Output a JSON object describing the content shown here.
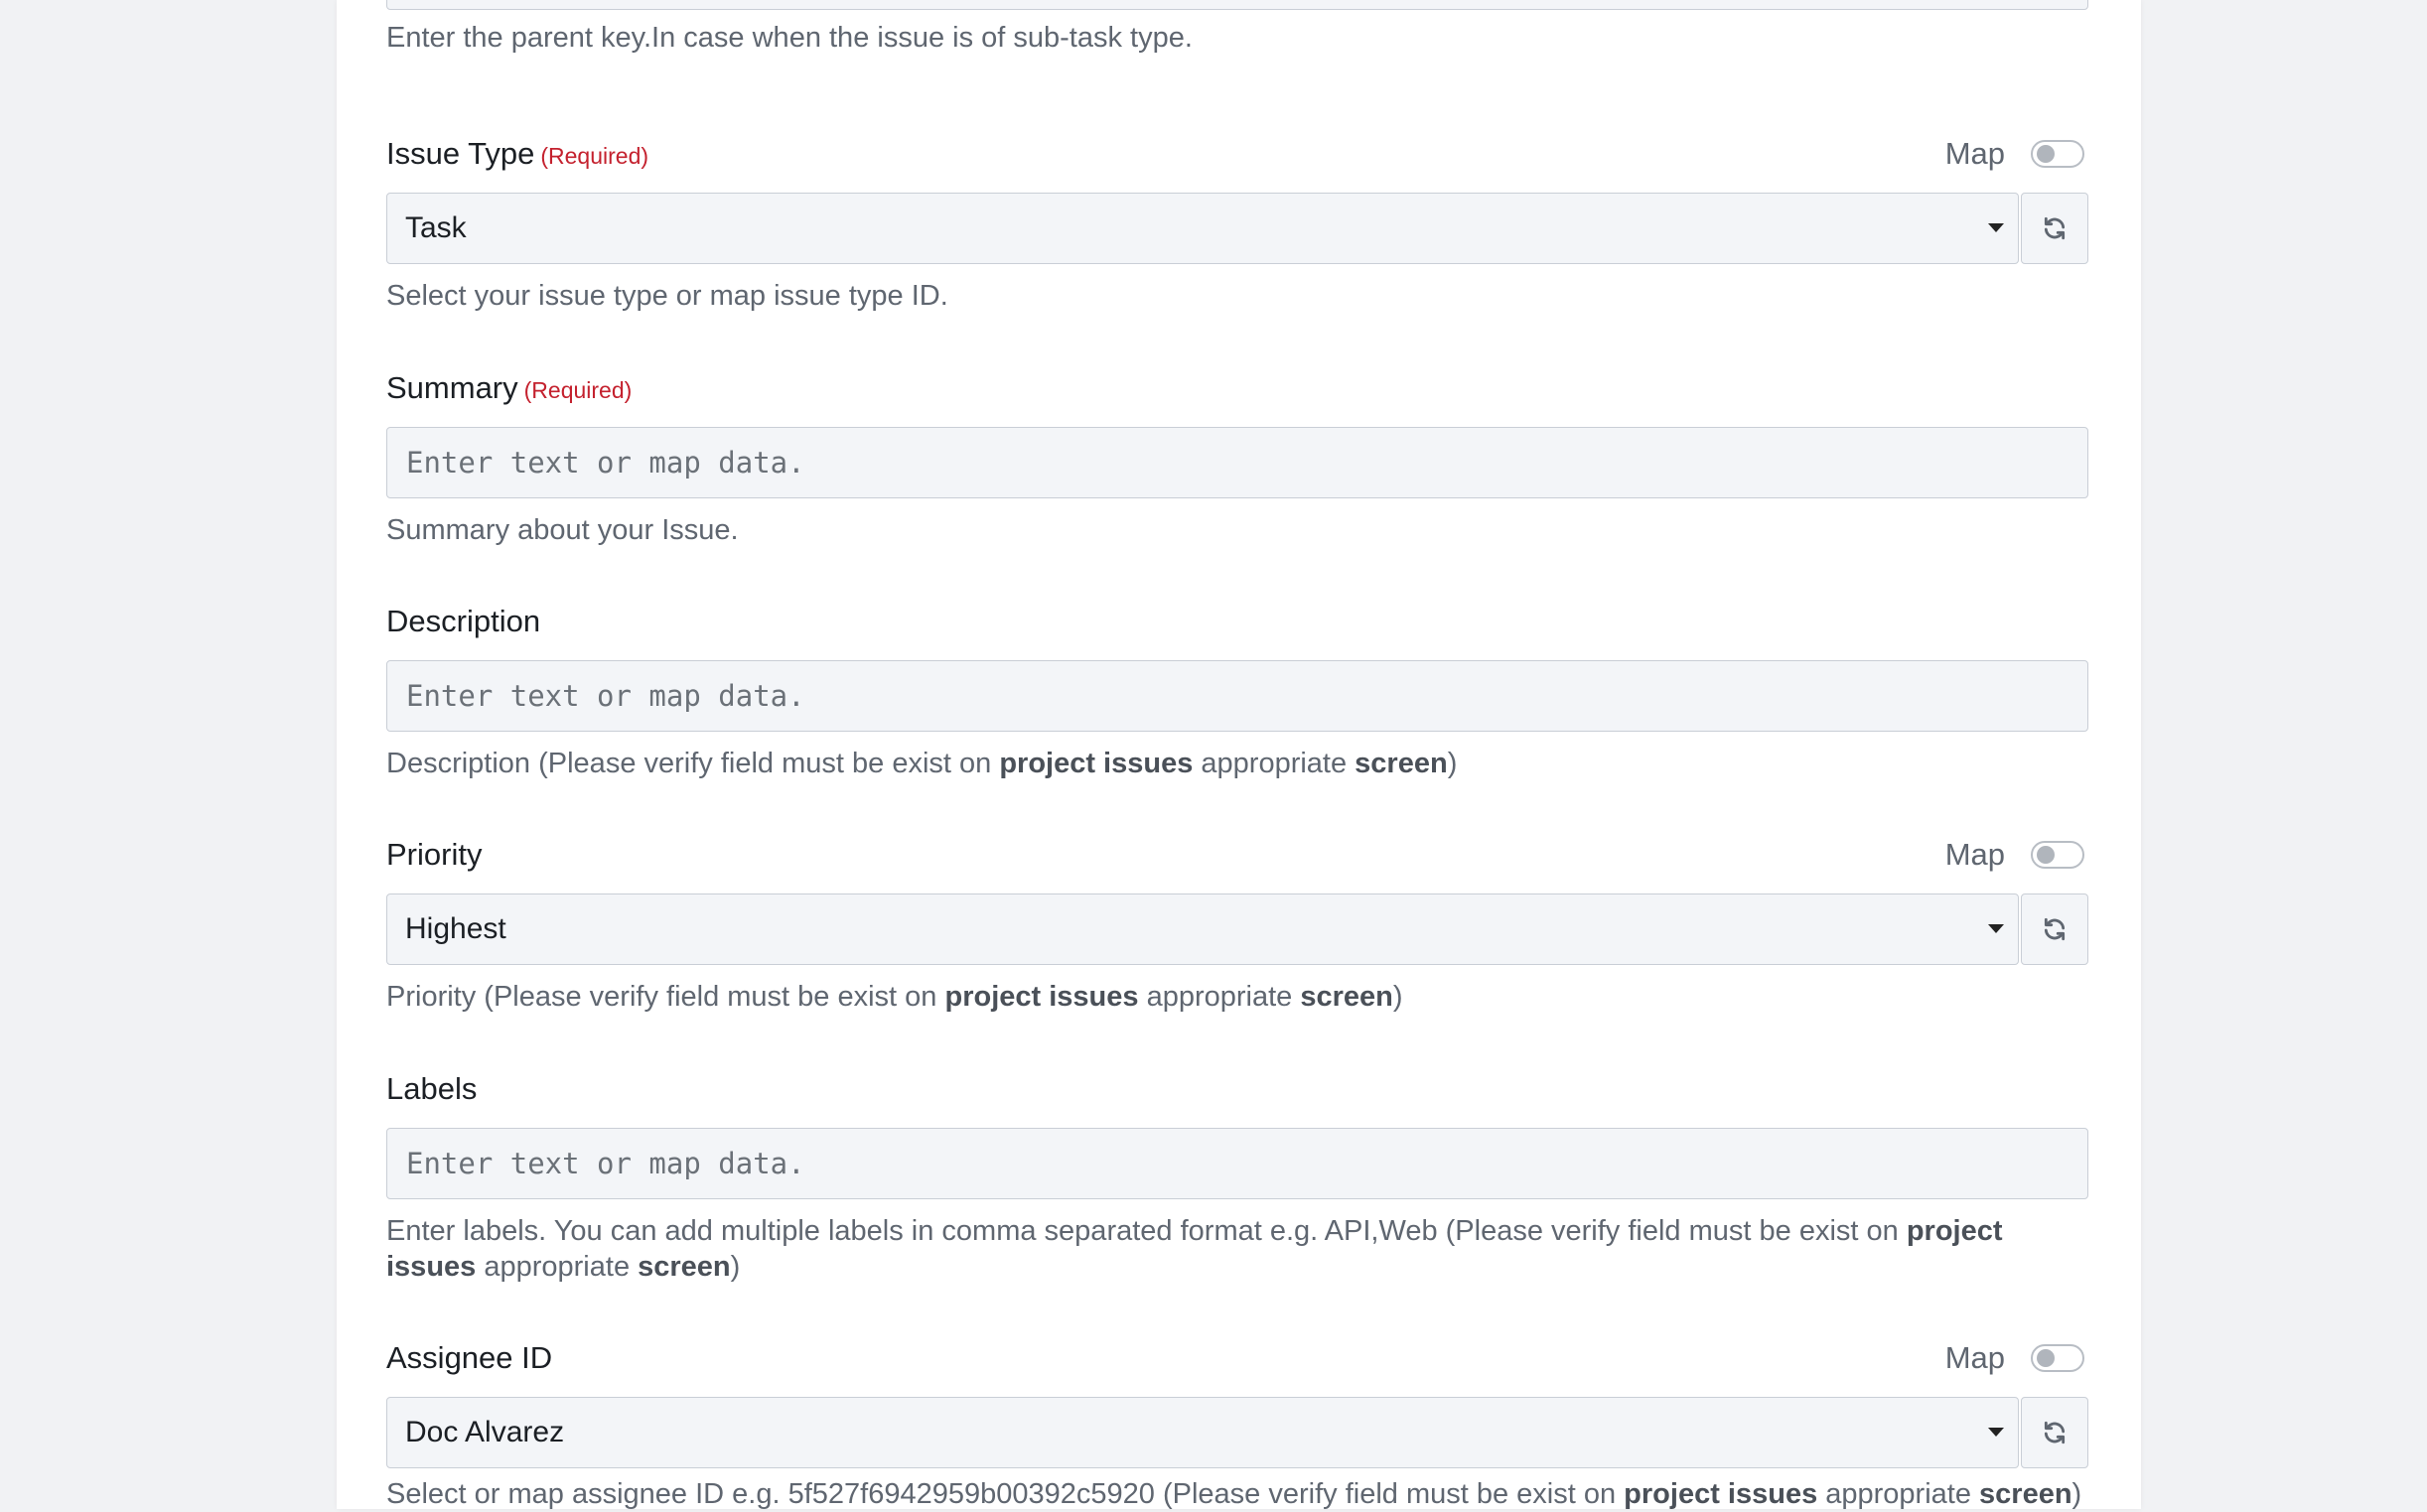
{
  "parent_key": {
    "help": "Enter the parent key.In case when the issue is of sub-task type."
  },
  "issue_type": {
    "label": "Issue Type",
    "required": "(Required)",
    "map_label": "Map",
    "value": "Task",
    "help": "Select your issue type or map issue type ID."
  },
  "summary": {
    "label": "Summary",
    "required": "(Required)",
    "placeholder": "Enter text or map data.",
    "help": "Summary about your Issue."
  },
  "description": {
    "label": "Description",
    "placeholder": "Enter text or map data.",
    "help_prefix": "Description (Please verify field must be exist on ",
    "help_bold1": "project issues",
    "help_middle": " appropriate ",
    "help_bold2": "screen",
    "help_suffix": ")"
  },
  "priority": {
    "label": "Priority",
    "map_label": "Map",
    "value": "Highest",
    "help_prefix": "Priority (Please verify field must be exist on ",
    "help_bold1": "project issues",
    "help_middle": " appropriate ",
    "help_bold2": "screen",
    "help_suffix": ")"
  },
  "labels": {
    "label": "Labels",
    "placeholder": "Enter text or map data.",
    "help_prefix": "Enter labels. You can add multiple labels in comma separated format e.g. API,Web (Please verify field must be exist on ",
    "help_bold1": "project issues",
    "help_middle": " appropriate ",
    "help_bold2": "screen",
    "help_suffix": ")"
  },
  "assignee": {
    "label": "Assignee ID",
    "map_label": "Map",
    "value": "Doc Alvarez",
    "help_prefix": "Select or map assignee ID e.g. 5f527f6942959b00392c5920 (Please verify field must be exist on ",
    "help_bold1": "project issues",
    "help_middle": " appropriate ",
    "help_bold2": "screen",
    "help_suffix": ")"
  },
  "icons": {
    "refresh": "refresh-icon",
    "caret": "caret-down-icon"
  },
  "colors": {
    "required": "#c4212e",
    "field_bg": "#f3f5f8",
    "border": "#c9ced6",
    "help_text": "#5f6670"
  }
}
